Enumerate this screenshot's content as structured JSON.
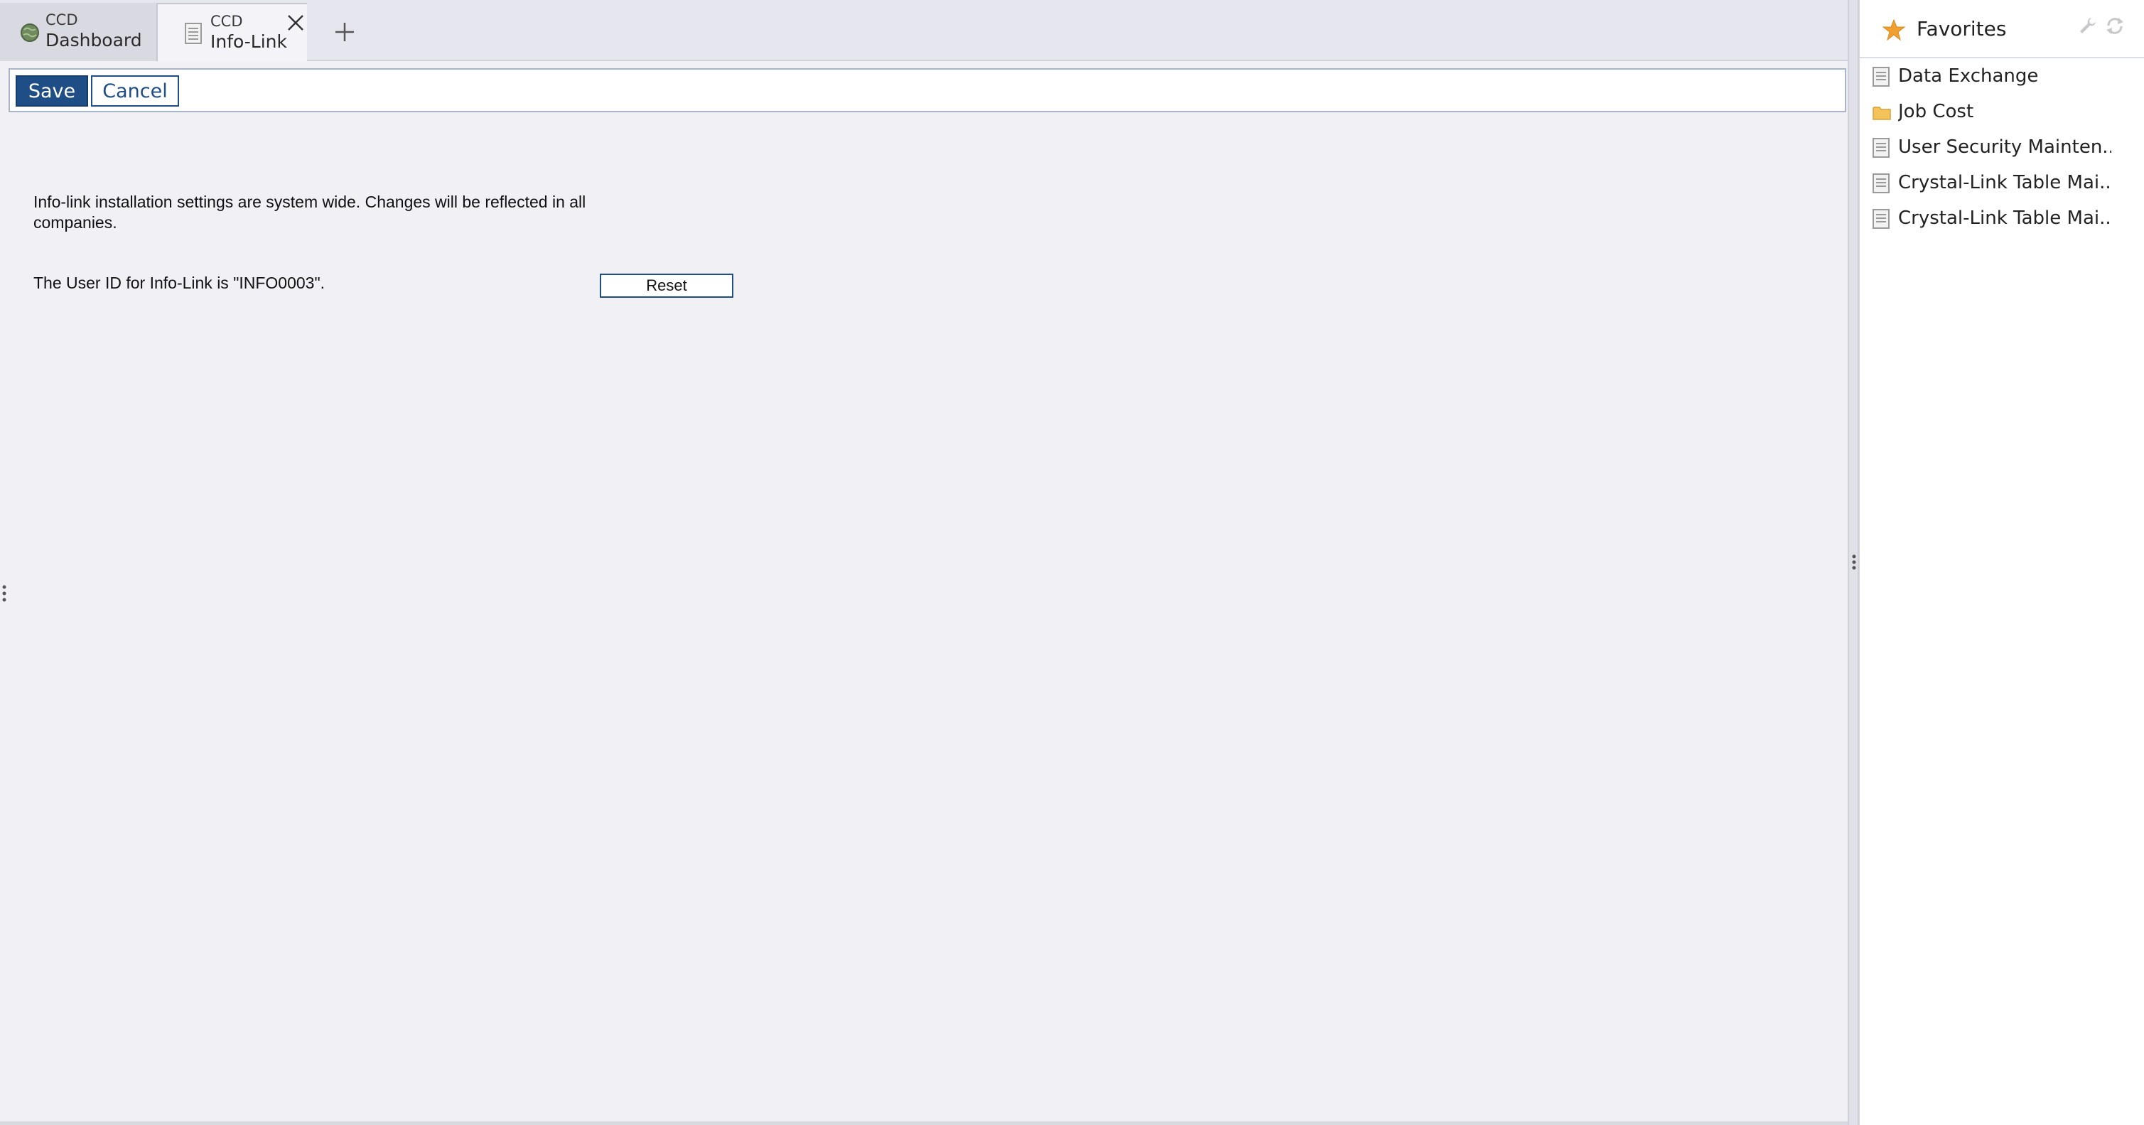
{
  "tabs": [
    {
      "sub": "CCD",
      "label": "Dashboard",
      "icon": "globe-icon",
      "active": false
    },
    {
      "sub": "CCD",
      "label": "Info-Link",
      "icon": "document-icon",
      "active": true
    }
  ],
  "toolbar": {
    "save_label": "Save",
    "cancel_label": "Cancel"
  },
  "content": {
    "info_text": "Info-link installation settings are system wide. Changes will be reflected in all companies.",
    "userid_text": "The User ID for Info-Link is \"INFO0003\".",
    "reset_label": "Reset"
  },
  "favorites": {
    "title": "Favorites",
    "items": [
      {
        "label": "Data Exchange",
        "icon": "document-icon"
      },
      {
        "label": "Job Cost",
        "icon": "folder-icon"
      },
      {
        "label": "User Security Mainten...",
        "icon": "document-icon"
      },
      {
        "label": "Crystal-Link Table Mai...",
        "icon": "document-icon"
      },
      {
        "label": "Crystal-Link Table Mai...",
        "icon": "document-icon"
      }
    ]
  },
  "colors": {
    "accent": "#1f4e86",
    "background": "#f0f0f5",
    "star": "#f0a030"
  }
}
